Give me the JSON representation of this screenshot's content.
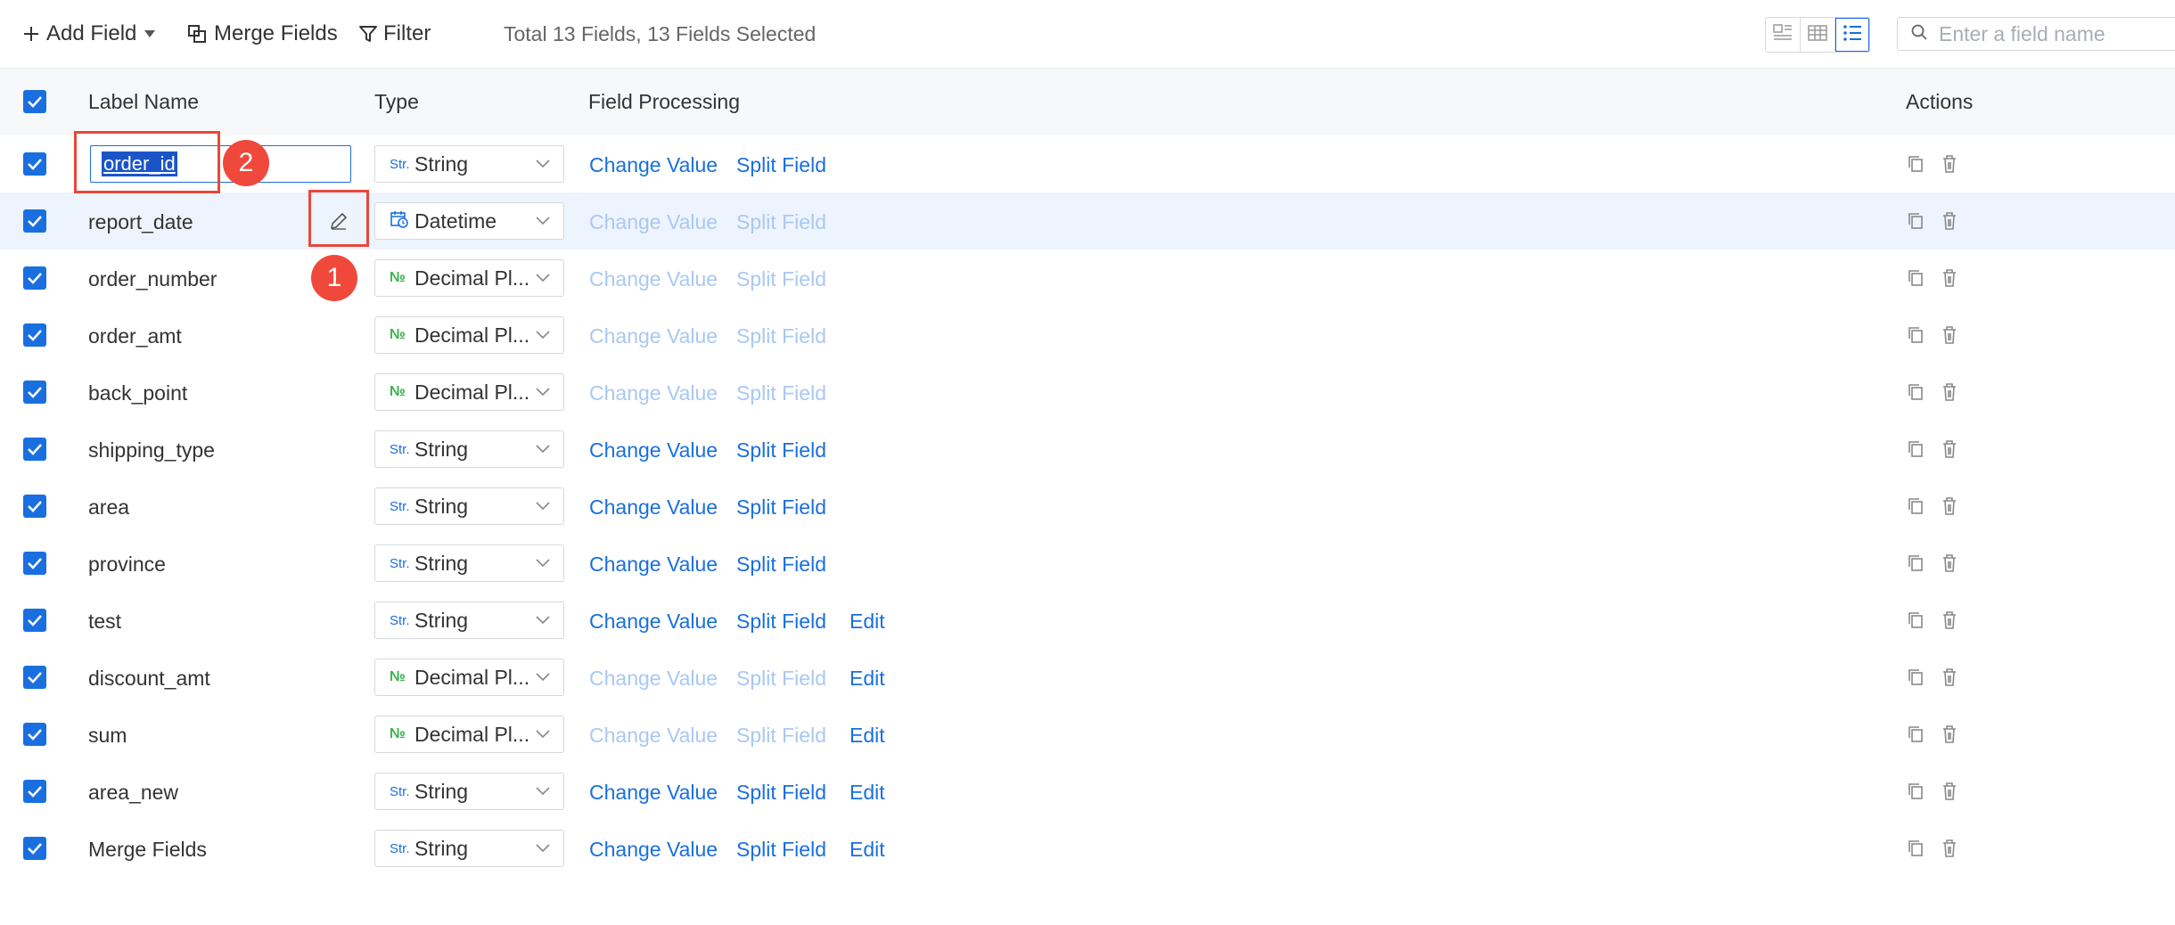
{
  "toolbar": {
    "add_field_label": "Add Field",
    "merge_fields_label": "Merge Fields",
    "filter_label": "Filter",
    "summary": "Total 13 Fields, 13 Fields Selected",
    "search_placeholder": "Enter a field name"
  },
  "header": {
    "label_name": "Label Name",
    "type": "Type",
    "field_processing": "Field Processing",
    "actions": "Actions"
  },
  "editing_value": "order_id",
  "annotations": [
    "1",
    "2"
  ],
  "rows": [
    {
      "label": "order_id",
      "type": "String",
      "type_icon": "Str.",
      "change_value": "Change Value",
      "split_field": "Split Field",
      "edit": ""
    },
    {
      "label": "report_date",
      "type": "Datetime",
      "type_icon": "calendar",
      "change_value": "Change Value",
      "split_field": "Split Field",
      "edit": ""
    },
    {
      "label": "order_number",
      "type": "Decimal Pl...",
      "type_icon": "№",
      "change_value": "Change Value",
      "split_field": "Split Field",
      "edit": ""
    },
    {
      "label": "order_amt",
      "type": "Decimal Pl...",
      "type_icon": "№",
      "change_value": "Change Value",
      "split_field": "Split Field",
      "edit": ""
    },
    {
      "label": "back_point",
      "type": "Decimal Pl...",
      "type_icon": "№",
      "change_value": "Change Value",
      "split_field": "Split Field",
      "edit": ""
    },
    {
      "label": "shipping_type",
      "type": "String",
      "type_icon": "Str.",
      "change_value": "Change Value",
      "split_field": "Split Field",
      "edit": ""
    },
    {
      "label": "area",
      "type": "String",
      "type_icon": "Str.",
      "change_value": "Change Value",
      "split_field": "Split Field",
      "edit": ""
    },
    {
      "label": "province",
      "type": "String",
      "type_icon": "Str.",
      "change_value": "Change Value",
      "split_field": "Split Field",
      "edit": ""
    },
    {
      "label": "test",
      "type": "String",
      "type_icon": "Str.",
      "change_value": "Change Value",
      "split_field": "Split Field",
      "edit": "Edit"
    },
    {
      "label": "discount_amt",
      "type": "Decimal Pl...",
      "type_icon": "№",
      "change_value": "Change Value",
      "split_field": "Split Field",
      "edit": "Edit"
    },
    {
      "label": "sum",
      "type": "Decimal Pl...",
      "type_icon": "№",
      "change_value": "Change Value",
      "split_field": "Split Field",
      "edit": "Edit"
    },
    {
      "label": "area_new",
      "type": "String",
      "type_icon": "Str.",
      "change_value": "Change Value",
      "split_field": "Split Field",
      "edit": "Edit"
    },
    {
      "label": "Merge Fields",
      "type": "String",
      "type_icon": "Str.",
      "change_value": "Change Value",
      "split_field": "Split Field",
      "edit": "Edit"
    }
  ]
}
